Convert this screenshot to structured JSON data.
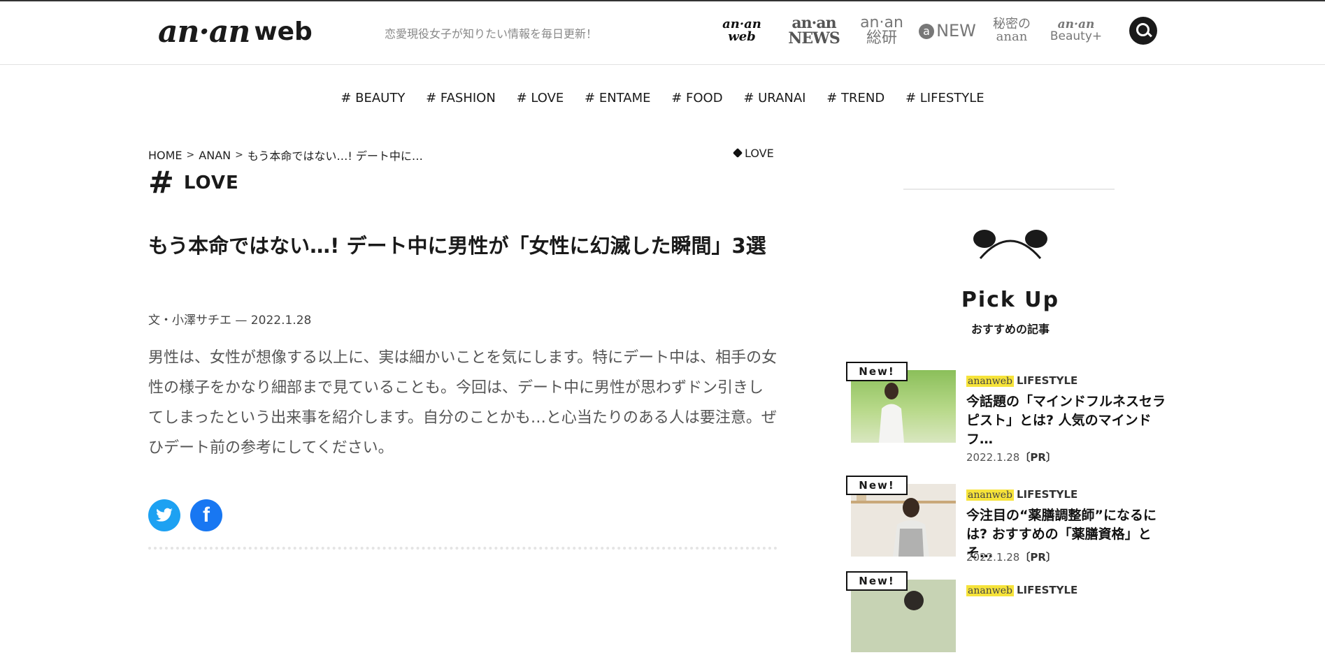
{
  "header": {
    "logo_main": "an·an",
    "logo_sub": "web",
    "tagline": "恋愛現役女子が知りたい情報を毎日更新！",
    "brands": {
      "web": {
        "top": "an·an",
        "bottom": "web"
      },
      "news": "an·an NEWS",
      "soken": "an·an 総研",
      "anew": {
        "mark": "a",
        "text": "NEW"
      },
      "himitsu": "秘密のanan",
      "beauty": {
        "top": "an·an",
        "bottom": "Beauty+"
      }
    }
  },
  "nav": {
    "items": [
      "# BEAUTY",
      "# FASHION",
      "# LOVE",
      "# ENTAME",
      "# FOOD",
      "# URANAI",
      "# TREND",
      "# LIFESTYLE"
    ]
  },
  "breadcrumb": {
    "home": "HOME",
    "section": "ANAN",
    "current": "もう本命ではない…! デート中に…",
    "sep": ">"
  },
  "tag": "LOVE",
  "category": {
    "hash": "#",
    "name": "LOVE"
  },
  "article": {
    "title": "もう本命ではない…! デート中に男性が「女性に幻滅した瞬間」3選",
    "byline": "文・小澤サチエ — 2022.1.28",
    "lead": "男性は、女性が想像する以上に、実は細かいことを気にします。特にデート中は、相手の女性の様子をかなり細部まで見ていることも。今回は、デート中に男性が思わずドン引きしてしまったという出来事を紹介します。自分のことかも…と心当たりのある人は要注意。ぜひデート前の参考にしてください。"
  },
  "share": {
    "twitter": "t",
    "facebook": "f"
  },
  "sidebar": {
    "pick_title": "Pick Up",
    "pick_sub": "おすすめの記事",
    "cards": [
      {
        "badge": "New!",
        "site": "ananweb",
        "cat": "LIFESTYLE",
        "title": "今話題の「マインドフルネスセラピスト」とは? 人気のマインドフ…",
        "date": "2022.1.28",
        "pr": "〔PR〕"
      },
      {
        "badge": "New!",
        "site": "ananweb",
        "cat": "LIFESTYLE",
        "title": "今注目の“薬膳調整師”になるには? おすすめの「薬膳資格」とそ…",
        "date": "2022.1.28",
        "pr": "〔PR〕"
      },
      {
        "badge": "New!",
        "site": "ananweb",
        "cat": "LIFESTYLE",
        "title": "",
        "date": "",
        "pr": ""
      }
    ]
  },
  "colors": {
    "accent_yellow": "#f6e33a",
    "twitter": "#1da1f2",
    "facebook": "#1877f2",
    "dark": "#1a1a1a"
  }
}
